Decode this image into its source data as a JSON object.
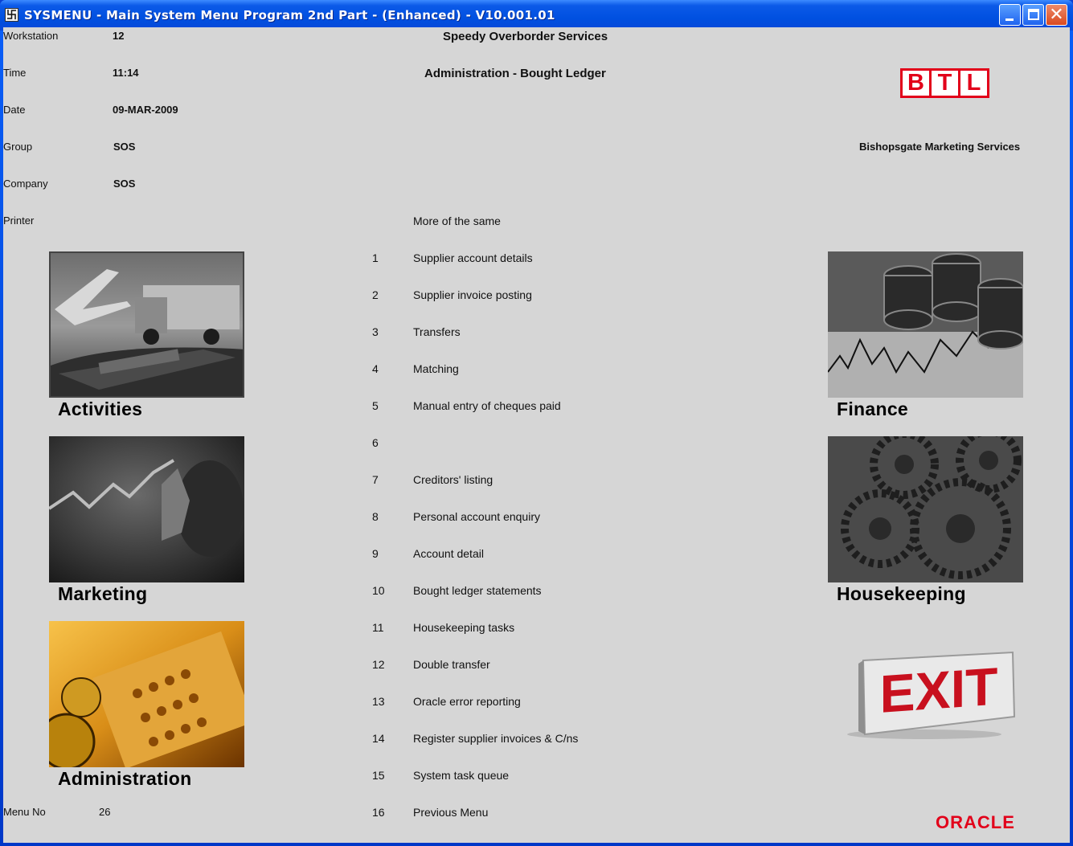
{
  "window": {
    "title": "SYSMENU - Main System Menu Program 2nd Part - (Enhanced) - V10.001.01",
    "icon": "app-icon"
  },
  "info": [
    {
      "label": "Workstation",
      "value": "12"
    },
    {
      "label": "Time",
      "value": "11:14"
    },
    {
      "label": "Date",
      "value": "09-MAR-2009"
    },
    {
      "label": "Group",
      "value": "SOS"
    },
    {
      "label": "Company",
      "value": "SOS"
    },
    {
      "label": "Printer",
      "value": ""
    }
  ],
  "header": {
    "company": "Speedy Overborder Services",
    "section": "Administration - Bought Ledger",
    "subtitle": "More of the same"
  },
  "brand": {
    "logo_letters": [
      "B",
      "T",
      "L"
    ],
    "name": "Bishopsgate Marketing Services",
    "oracle": "ORACLE",
    "accent_color": "#e2001a"
  },
  "menu": [
    {
      "num": "1",
      "label": "Supplier account details"
    },
    {
      "num": "2",
      "label": "Supplier invoice posting"
    },
    {
      "num": "3",
      "label": "Transfers"
    },
    {
      "num": "4",
      "label": "Matching"
    },
    {
      "num": "5",
      "label": "Manual entry of cheques paid"
    },
    {
      "num": "6",
      "label": ""
    },
    {
      "num": "7",
      "label": "Creditors' listing"
    },
    {
      "num": "8",
      "label": "Personal account enquiry"
    },
    {
      "num": "9",
      "label": "Account detail"
    },
    {
      "num": "10",
      "label": "Bought ledger statements"
    },
    {
      "num": "11",
      "label": "Housekeeping tasks"
    },
    {
      "num": "12",
      "label": "Double transfer"
    },
    {
      "num": "13",
      "label": "Oracle error reporting"
    },
    {
      "num": "14",
      "label": "Register supplier invoices & C/ns"
    },
    {
      "num": "15",
      "label": "System task queue"
    },
    {
      "num": "16",
      "label": "Previous Menu"
    }
  ],
  "tiles": {
    "activities": "Activities",
    "marketing": "Marketing",
    "administration": "Administration",
    "finance": "Finance",
    "housekeeping": "Housekeeping",
    "exit": "EXIT"
  },
  "menu_no": {
    "label": "Menu No",
    "value": "26"
  }
}
